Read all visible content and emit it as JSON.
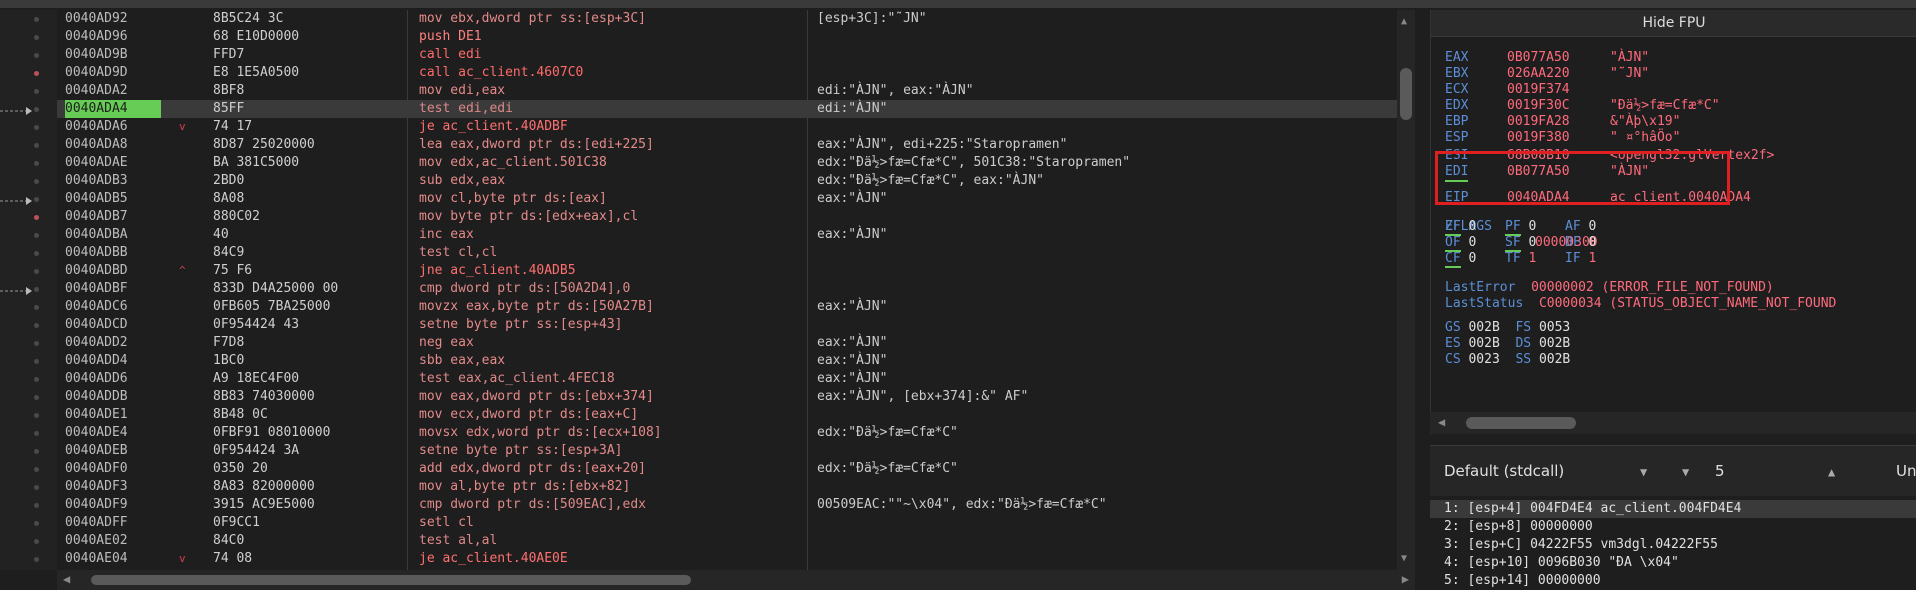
{
  "disasm": {
    "rows": [
      {
        "addr": "0040AD92",
        "jmp": "",
        "bytes": "8B5C24 3C",
        "instr": "mov ebx,dword ptr ss:[esp+3C]",
        "kind": "mov",
        "comment": "[esp+3C]:\"˜JN\""
      },
      {
        "addr": "0040AD96",
        "jmp": "",
        "bytes": "68 E10D0000",
        "instr": "push DE1",
        "kind": "push",
        "comment": ""
      },
      {
        "addr": "0040AD9B",
        "jmp": "",
        "bytes": "FFD7",
        "instr": "call edi",
        "kind": "call",
        "comment": ""
      },
      {
        "addr": "0040AD9D",
        "jmp": "",
        "bytes": "E8 1E5A0500",
        "instr": "call ac_client.4607C0",
        "kind": "call",
        "comment": ""
      },
      {
        "addr": "0040ADA2",
        "jmp": "",
        "bytes": "8BF8",
        "instr": "mov edi,eax",
        "kind": "mov",
        "comment": "edi:\"ÀJN\", eax:\"ÀJN\""
      },
      {
        "addr": "0040ADA4",
        "jmp": "",
        "bytes": "85FF",
        "instr": "test edi,edi",
        "kind": "test",
        "comment": "edi:\"ÀJN\""
      },
      {
        "addr": "0040ADA6",
        "jmp": "v",
        "bytes": "74 17",
        "instr": "je ac_client.40ADBF",
        "kind": "jmp",
        "comment": ""
      },
      {
        "addr": "0040ADA8",
        "jmp": "",
        "bytes": "8D87 25020000",
        "instr": "lea eax,dword ptr ds:[edi+225]",
        "kind": "mov",
        "comment": "eax:\"ÀJN\", edi+225:\"Staropramen\""
      },
      {
        "addr": "0040ADAE",
        "jmp": "",
        "bytes": "BA 381C5000",
        "instr": "mov edx,ac_client.501C38",
        "kind": "mov",
        "comment": "edx:\"Ðä½>fæ=Cfæ*C\", 501C38:\"Staropramen\""
      },
      {
        "addr": "0040ADB3",
        "jmp": "",
        "bytes": "2BD0",
        "instr": "sub edx,eax",
        "kind": "mov",
        "comment": "edx:\"Ðä½>fæ=Cfæ*C\", eax:\"ÀJN\""
      },
      {
        "addr": "0040ADB5",
        "jmp": "",
        "bytes": "8A08",
        "instr": "mov cl,byte ptr ds:[eax]",
        "kind": "mov",
        "comment": "eax:\"ÀJN\""
      },
      {
        "addr": "0040ADB7",
        "jmp": "",
        "bytes": "880C02",
        "instr": "mov byte ptr ds:[edx+eax],cl",
        "kind": "mov",
        "comment": ""
      },
      {
        "addr": "0040ADBA",
        "jmp": "",
        "bytes": "40",
        "instr": "inc eax",
        "kind": "mov",
        "comment": "eax:\"ÀJN\""
      },
      {
        "addr": "0040ADBB",
        "jmp": "",
        "bytes": "84C9",
        "instr": "test cl,cl",
        "kind": "test",
        "comment": ""
      },
      {
        "addr": "0040ADBD",
        "jmp": "^",
        "bytes": "75 F6",
        "instr": "jne ac_client.40ADB5",
        "kind": "jmp",
        "comment": ""
      },
      {
        "addr": "0040ADBF",
        "jmp": "",
        "bytes": "833D D4A25000 00",
        "instr": "cmp dword ptr ds:[50A2D4],0",
        "kind": "test",
        "comment": ""
      },
      {
        "addr": "0040ADC6",
        "jmp": "",
        "bytes": "0FB605 7BA25000",
        "instr": "movzx eax,byte ptr ds:[50A27B]",
        "kind": "mov",
        "comment": "eax:\"ÀJN\""
      },
      {
        "addr": "0040ADCD",
        "jmp": "",
        "bytes": "0F954424 43",
        "instr": "setne byte ptr ss:[esp+43]",
        "kind": "mov",
        "comment": ""
      },
      {
        "addr": "0040ADD2",
        "jmp": "",
        "bytes": "F7D8",
        "instr": "neg eax",
        "kind": "mov",
        "comment": "eax:\"ÀJN\""
      },
      {
        "addr": "0040ADD4",
        "jmp": "",
        "bytes": "1BC0",
        "instr": "sbb eax,eax",
        "kind": "mov",
        "comment": "eax:\"ÀJN\""
      },
      {
        "addr": "0040ADD6",
        "jmp": "",
        "bytes": "A9 18EC4F00",
        "instr": "test eax,ac_client.4FEC18",
        "kind": "test",
        "comment": "eax:\"ÀJN\""
      },
      {
        "addr": "0040ADDB",
        "jmp": "",
        "bytes": "8B83 74030000",
        "instr": "mov eax,dword ptr ds:[ebx+374]",
        "kind": "mov",
        "comment": "eax:\"ÀJN\", [ebx+374]:&\" AF\""
      },
      {
        "addr": "0040ADE1",
        "jmp": "",
        "bytes": "8B48 0C",
        "instr": "mov ecx,dword ptr ds:[eax+C]",
        "kind": "mov",
        "comment": ""
      },
      {
        "addr": "0040ADE4",
        "jmp": "",
        "bytes": "0FBF91 08010000",
        "instr": "movsx edx,word ptr ds:[ecx+108]",
        "kind": "mov",
        "comment": "edx:\"Ðä½>fæ=Cfæ*C\""
      },
      {
        "addr": "0040ADEB",
        "jmp": "",
        "bytes": "0F954424 3A",
        "instr": "setne byte ptr ss:[esp+3A]",
        "kind": "mov",
        "comment": ""
      },
      {
        "addr": "0040ADF0",
        "jmp": "",
        "bytes": "0350 20",
        "instr": "add edx,dword ptr ds:[eax+20]",
        "kind": "mov",
        "comment": "edx:\"Ðä½>fæ=Cfæ*C\""
      },
      {
        "addr": "0040ADF3",
        "jmp": "",
        "bytes": "8A83 82000000",
        "instr": "mov al,byte ptr ds:[ebx+82]",
        "kind": "mov",
        "comment": ""
      },
      {
        "addr": "0040ADF9",
        "jmp": "",
        "bytes": "3915 AC9E5000",
        "instr": "cmp dword ptr ds:[509EAC],edx",
        "kind": "test",
        "comment": "00509EAC:\"\"~\\x04\", edx:\"Ðä½>fæ=Cfæ*C\""
      },
      {
        "addr": "0040ADFF",
        "jmp": "",
        "bytes": "0F9CC1",
        "instr": "setl cl",
        "kind": "mov",
        "comment": ""
      },
      {
        "addr": "0040AE02",
        "jmp": "",
        "bytes": "84C0",
        "instr": "test al,al",
        "kind": "test",
        "comment": ""
      },
      {
        "addr": "0040AE04",
        "jmp": "v",
        "bytes": "74 08",
        "instr": "je ac_client.40AE0E",
        "kind": "jmp",
        "comment": ""
      }
    ]
  },
  "fpu": {
    "hide_label": "Hide FPU"
  },
  "registers": [
    {
      "name": "EAX",
      "value": "0B077A50",
      "comment": "\"ÀJN\""
    },
    {
      "name": "EBX",
      "value": "026AA220",
      "comment": "\"˜JN\""
    },
    {
      "name": "ECX",
      "value": "0019F374",
      "comment": ""
    },
    {
      "name": "EDX",
      "value": "0019F30C",
      "comment": "\"Ðä½>fæ=Cfæ*C\""
    },
    {
      "name": "EBP",
      "value": "0019FA28",
      "comment": "&\"Àþ\\x19\""
    },
    {
      "name": "ESP",
      "value": "0019F380",
      "comment": "\" ¤°hâÖo\""
    },
    {
      "name": "ESI",
      "value": "68B08B10",
      "comment": "<opengl32.glVertex2f>"
    },
    {
      "name": "EDI",
      "value": "0B077A50",
      "comment": "\"ÀJN\""
    },
    {
      "name": "EIP",
      "value": "0040ADA4",
      "comment": "ac_client.0040ADA4"
    }
  ],
  "eflags": {
    "name": "EFLAGS",
    "value": "00000300"
  },
  "flags": [
    {
      "name": "ZF",
      "value": "0"
    },
    {
      "name": "PF",
      "value": "0"
    },
    {
      "name": "AF",
      "value": "0"
    },
    {
      "name": "OF",
      "value": "0"
    },
    {
      "name": "SF",
      "value": "0"
    },
    {
      "name": "DF",
      "value": "0"
    },
    {
      "name": "CF",
      "value": "0"
    },
    {
      "name": "TF",
      "value": "1"
    },
    {
      "name": "IF",
      "value": "1"
    }
  ],
  "errors": [
    {
      "name": "LastError",
      "value": "00000002 (ERROR_FILE_NOT_FOUND)"
    },
    {
      "name": "LastStatus",
      "value": "C0000034 (STATUS_OBJECT_NAME_NOT_FOUND"
    }
  ],
  "segments": [
    {
      "a": "GS",
      "av": "002B",
      "b": "FS",
      "bv": "0053"
    },
    {
      "a": "ES",
      "av": "002B",
      "b": "DS",
      "bv": "002B"
    },
    {
      "a": "CS",
      "av": "0023",
      "b": "SS",
      "bv": "002B"
    }
  ],
  "callconv": {
    "selected": "Default (stdcall)",
    "count": "5",
    "unlock_label": "Un"
  },
  "stack": [
    "1: [esp+4] 004FD4E4 ac_client.004FD4E4",
    "2: [esp+8] 00000000",
    "3: [esp+C] 04222F55 vm3dgl.04222F55",
    "4: [esp+10] 0096B030 \"ÐA \\x04\"",
    "5: [esp+14] 00000000"
  ],
  "colors": {
    "accent_highlight": "#66cc55",
    "annotation_box": "#e02020",
    "register_name": "#5b8fd6",
    "register_value": "#ff6b7c"
  }
}
